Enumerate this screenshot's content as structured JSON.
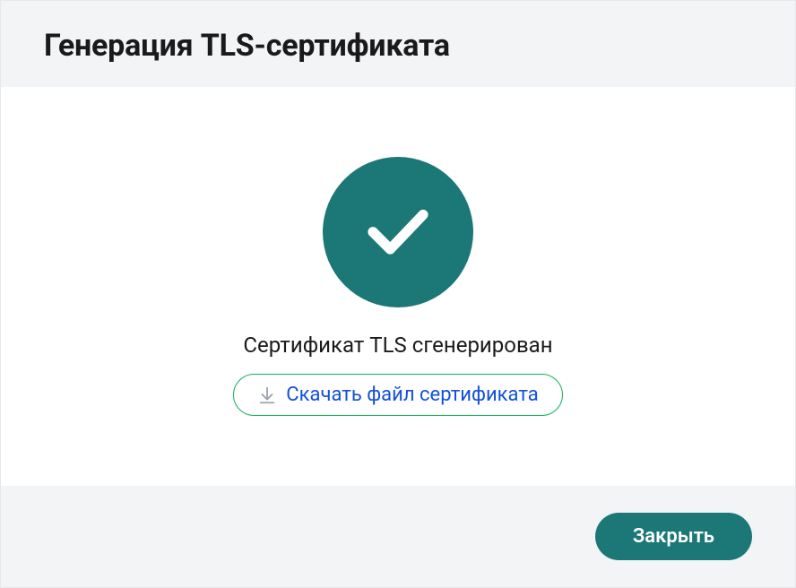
{
  "dialog": {
    "title": "Генерация TLS-сертификата",
    "status_text": "Сертификат TLS сгенерирован",
    "download_label": "Скачать файл сертификата",
    "close_label": "Закрыть"
  },
  "colors": {
    "accent": "#1c7876",
    "success_border": "#0fb257",
    "link": "#1351d8"
  },
  "icons": {
    "success": "checkmark-icon",
    "download": "download-icon"
  }
}
